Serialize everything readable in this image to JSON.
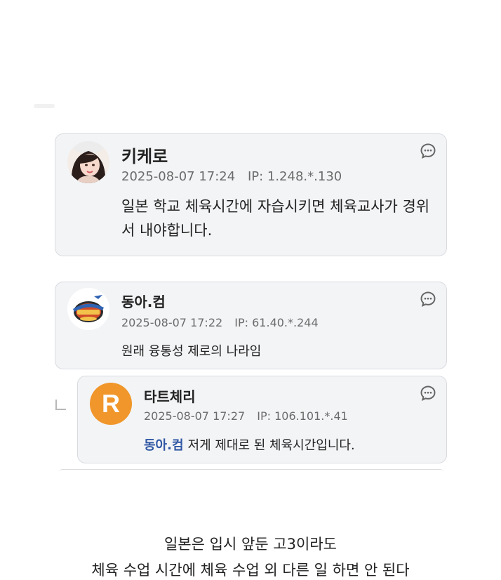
{
  "comments": [
    {
      "nickname": "키케로",
      "date": "2025-08-07 17:24",
      "ip": "IP: 1.248.*.130",
      "text": "일본 학교 체육시간에 자습시키면 체육교사가 경위서 내야합니다.",
      "avatar": "profile-photo",
      "reply_icon": "chat-bubble-icon"
    },
    {
      "nickname": "동아.컴",
      "date": "2025-08-07 17:22",
      "ip": "IP: 61.40.*.244",
      "text": "원래 융통성 제로의 나라임",
      "avatar": "team-logo",
      "reply_icon": "chat-bubble-icon"
    },
    {
      "nickname": "타트체리",
      "date": "2025-08-07 17:27",
      "ip": "IP: 106.101.*.41",
      "mention": "동아.컴",
      "text": "저게 제대로 된 체육시간입니다.",
      "avatar_letter": "R",
      "avatar_color": "#f0962a",
      "reply_icon": "chat-bubble-icon"
    }
  ],
  "article": {
    "lines": [
      "일본은 입시 앞둔 고3이라도",
      "체육 수업 시간에 체육 수업 외 다른 일 하면 안 된다"
    ]
  },
  "colors": {
    "card_bg": "#f3f4f6",
    "card_border": "#d9dbe0",
    "mention": "#2f56a4",
    "meta": "#6b6b6b"
  }
}
